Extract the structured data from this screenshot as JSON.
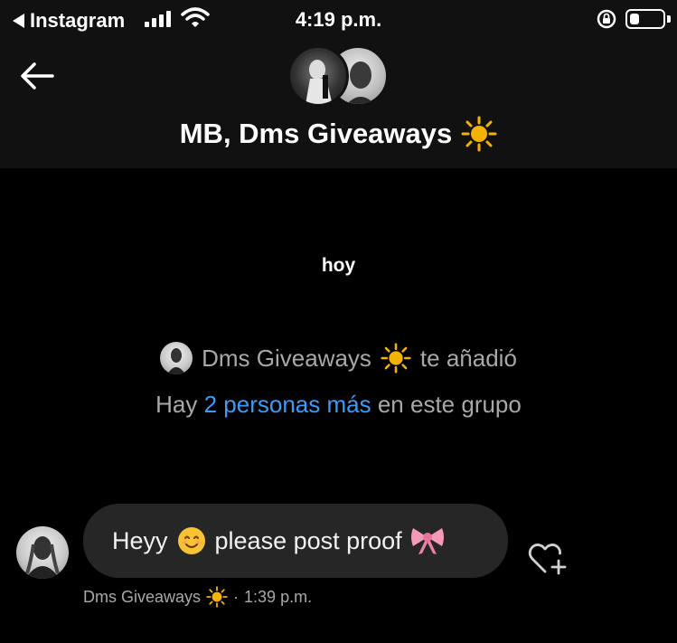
{
  "status_bar": {
    "back_app": "Instagram",
    "time": "4:19 p.m.",
    "battery_level": 0.3
  },
  "header": {
    "title": "MB, Dms Giveaways"
  },
  "thread": {
    "date_label": "hoy",
    "system_message": {
      "actor": "Dms Giveaways",
      "action": "te añadió"
    },
    "members_line": {
      "prefix": "Hay",
      "link": "2 personas más",
      "suffix": "en este grupo"
    },
    "messages": [
      {
        "text_before": "Heyy",
        "text_middle": "please post proof",
        "sender": "Dms Giveaways",
        "time": "1:39 p.m."
      }
    ]
  },
  "colors": {
    "background": "#000000",
    "header_background": "#111111",
    "bubble": "#262626",
    "secondary_text": "#a8a8a8",
    "link": "#3d9bf7",
    "sun": "#f5b301"
  },
  "icons": {
    "status_back": "back-triangle-icon",
    "signal": "cellular-signal-icon",
    "wifi": "wifi-icon",
    "rotation_lock": "rotation-lock-icon",
    "battery": "battery-icon",
    "nav_back": "arrow-left-icon",
    "sun": "sun-emoji-icon",
    "smile": "smiling-face-emoji-icon",
    "bow": "ribbon-emoji-icon",
    "react": "heart-plus-icon"
  }
}
